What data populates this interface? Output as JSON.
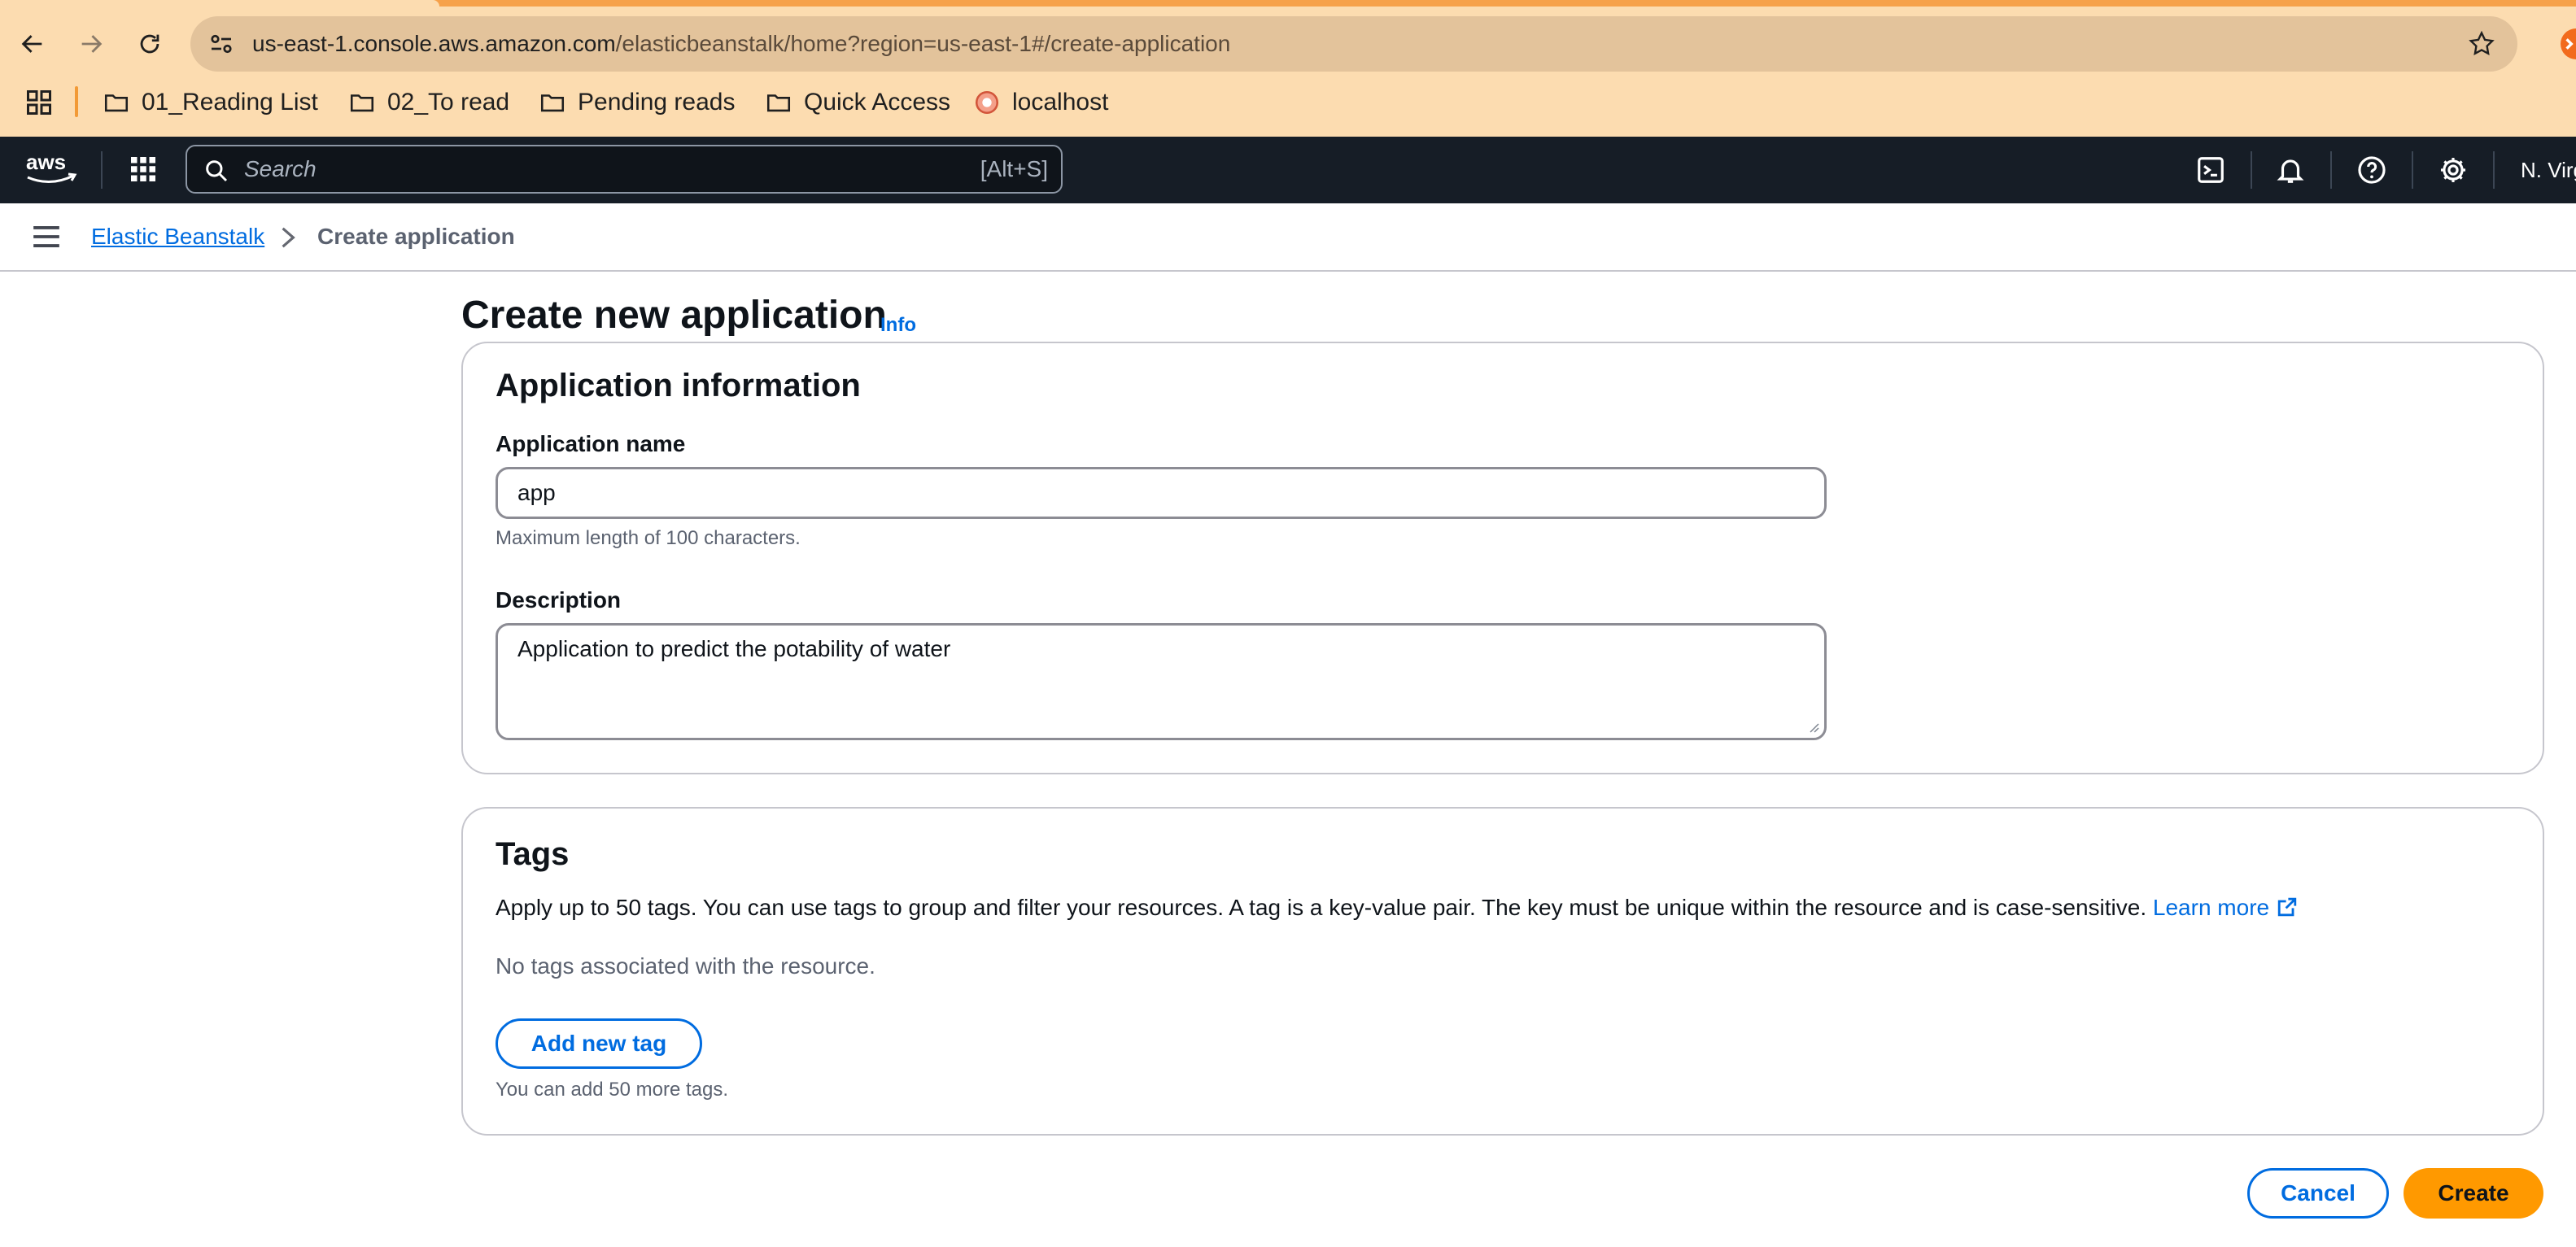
{
  "browser": {
    "url_host": "us-east-1.console.aws.amazon.com",
    "url_path": "/elasticbeanstalk/home?region=us-east-1#/create-application",
    "bookmarks": [
      "01_Reading List",
      "02_To read",
      "Pending reads",
      "Quick Access",
      "localhost"
    ]
  },
  "aws_nav": {
    "search_placeholder": "Search",
    "search_shortcut": "[Alt+S]",
    "region": "N. Virginia"
  },
  "breadcrumb": {
    "service": "Elastic Beanstalk",
    "current": "Create application"
  },
  "page": {
    "title": "Create new application",
    "info": "Info"
  },
  "app_info": {
    "heading": "Application information",
    "name_label": "Application name",
    "name_value": "app",
    "name_hint": "Maximum length of 100 characters.",
    "desc_label": "Description",
    "desc_value": "Application to predict the potability of water"
  },
  "tags": {
    "heading": "Tags",
    "description": "Apply up to 50 tags. You can use tags to group and filter your resources. A tag is a key-value pair. The key must be unique within the resource and is case-sensitive.",
    "learn_more": "Learn more",
    "empty_text": "No tags associated with the resource.",
    "add_button": "Add new tag",
    "remaining_hint": "You can add 50 more tags."
  },
  "actions": {
    "cancel": "Cancel",
    "create": "Create"
  },
  "colors": {
    "link": "#006ce0",
    "primary_button": "#ff9900",
    "aws_nav_bg": "#161d26",
    "browser_bg": "#fcdcb0"
  }
}
